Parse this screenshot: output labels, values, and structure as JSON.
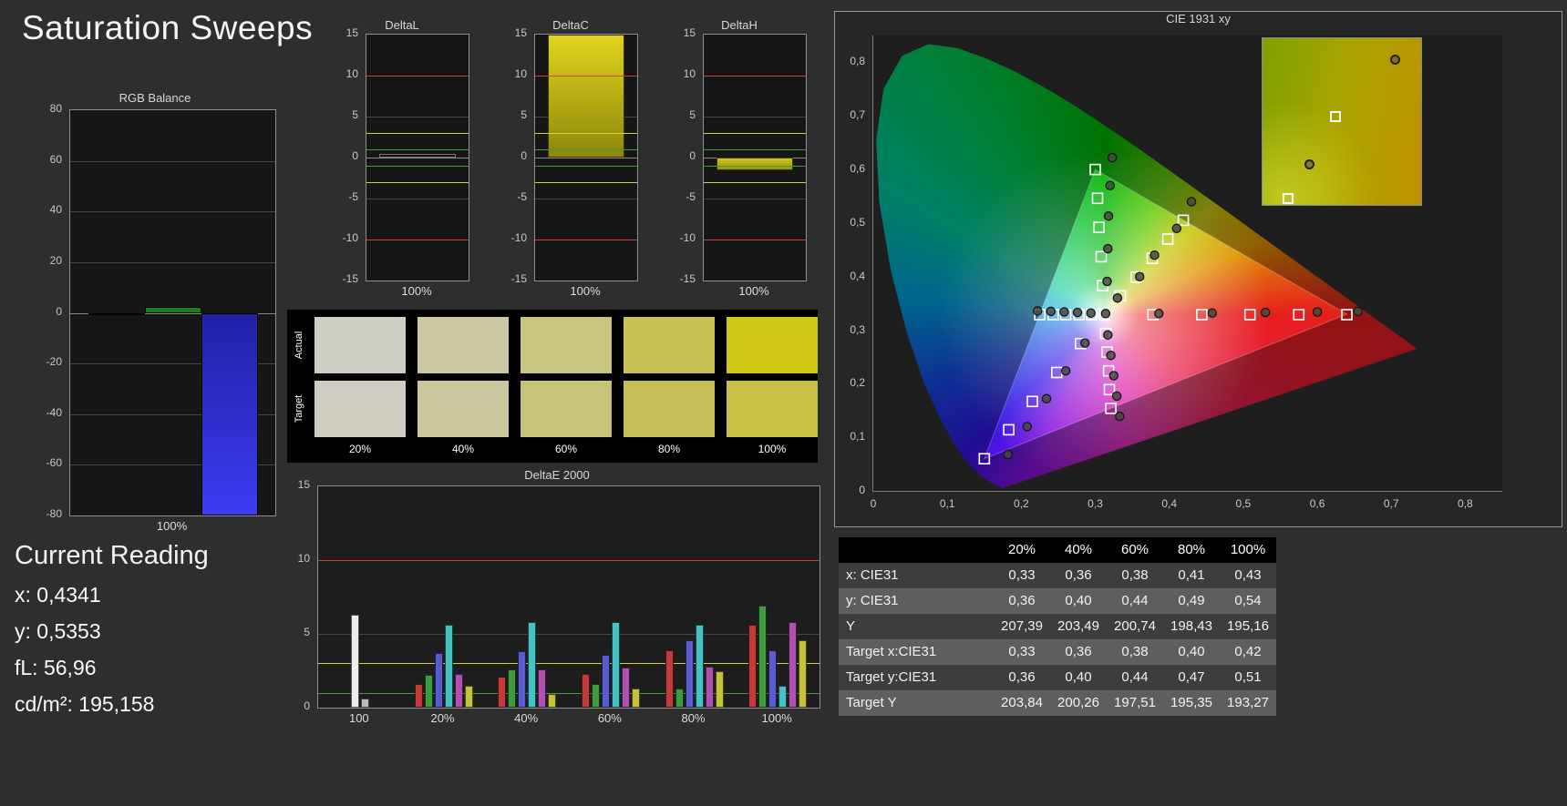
{
  "page": {
    "title": "Saturation Sweeps"
  },
  "colors": {
    "background": "#2e2e2e",
    "panel_border": "#8f8f8f",
    "ref_red": "#d23c3c",
    "ref_yellow": "#d2d23c",
    "ref_green": "#3ca03c"
  },
  "current_reading": {
    "title": "Current Reading",
    "lines": [
      {
        "label": "x:",
        "value": "0,4341"
      },
      {
        "label": "y:",
        "value": "0,5353"
      },
      {
        "label": "fL:",
        "value": "56,96"
      },
      {
        "label": "cd/m²:",
        "value": "195,158"
      }
    ]
  },
  "swatches": {
    "row_labels": [
      "Actual",
      "Target"
    ],
    "labels": [
      "20%",
      "40%",
      "60%",
      "80%",
      "100%"
    ],
    "actual": [
      "#cfcec4",
      "#ccc9a2",
      "#cac57e",
      "#c7c055",
      "#cfc915"
    ],
    "target": [
      "#cfcdc1",
      "#cbc89f",
      "#c8c37b",
      "#c5bf58",
      "#c8c145"
    ]
  },
  "table": {
    "headers": [
      "",
      "20%",
      "40%",
      "60%",
      "80%",
      "100%"
    ],
    "rows": [
      {
        "label": "x: CIE31",
        "values": [
          "0,33",
          "0,36",
          "0,38",
          "0,41",
          "0,43"
        ]
      },
      {
        "label": "y: CIE31",
        "values": [
          "0,36",
          "0,40",
          "0,44",
          "0,49",
          "0,54"
        ]
      },
      {
        "label": "Y",
        "values": [
          "207,39",
          "203,49",
          "200,74",
          "198,43",
          "195,16"
        ]
      },
      {
        "label": "Target x:CIE31",
        "values": [
          "0,33",
          "0,36",
          "0,38",
          "0,40",
          "0,42"
        ]
      },
      {
        "label": "Target y:CIE31",
        "values": [
          "0,36",
          "0,40",
          "0,44",
          "0,47",
          "0,51"
        ]
      },
      {
        "label": "Target Y",
        "values": [
          "203,84",
          "200,26",
          "197,51",
          "195,35",
          "193,27"
        ]
      }
    ],
    "row_bg_dark": "#3d3d3d",
    "row_bg_light": "#5e5e5e"
  },
  "chart_data": [
    {
      "id": "rgb-balance",
      "type": "bar",
      "title": "RGB Balance",
      "categories": [
        "100%"
      ],
      "xlabel": "100%",
      "ylim": [
        -80,
        80
      ],
      "yticks": [
        80,
        60,
        40,
        20,
        0,
        -20,
        -40,
        -60,
        -80
      ],
      "series": [
        {
          "name": "Red",
          "values": [
            -1
          ],
          "color": "#5a1616",
          "border": "#000000"
        },
        {
          "name": "Green",
          "values": [
            2.5
          ],
          "color": "#1d7d1d",
          "border": "#000000"
        },
        {
          "name": "Blue",
          "values": [
            -80
          ],
          "gradient": [
            "#2121a6",
            "#3c3cf2"
          ],
          "border": "#000000"
        }
      ]
    },
    {
      "id": "delta-l",
      "type": "bar",
      "title": "DeltaL",
      "categories": [
        "100%"
      ],
      "xlabel": "100%",
      "values": [
        0.4
      ],
      "ylim": [
        -15,
        15
      ],
      "yticks": [
        15,
        10,
        5,
        0,
        -5,
        -10,
        -15
      ],
      "ref_lines": [
        {
          "y": 10,
          "color": "#d23c3c"
        },
        {
          "y": 3,
          "color": "#d2d23c"
        },
        {
          "y": 1,
          "color": "#3ca03c"
        },
        {
          "y": -1,
          "color": "#3ca03c"
        },
        {
          "y": -3,
          "color": "#d2d23c"
        },
        {
          "y": -10,
          "color": "#d23c3c"
        }
      ],
      "bar_color": "#0e0e0e",
      "bar_border": "#787878"
    },
    {
      "id": "delta-c",
      "type": "bar",
      "title": "DeltaC",
      "categories": [
        "100%"
      ],
      "xlabel": "100%",
      "values": [
        16
      ],
      "ylim": [
        -15,
        15
      ],
      "yticks": [
        15,
        10,
        5,
        0,
        -5,
        -10,
        -15
      ],
      "ref_lines": [
        {
          "y": 10,
          "color": "#d23c3c"
        },
        {
          "y": 3,
          "color": "#d2d23c"
        },
        {
          "y": 1,
          "color": "#3ca03c"
        },
        {
          "y": -1,
          "color": "#3ca03c"
        },
        {
          "y": -3,
          "color": "#d2d23c"
        },
        {
          "y": -10,
          "color": "#d23c3c"
        }
      ],
      "bar_gradient": [
        "#e0d41c",
        "#8e880c"
      ],
      "bar_border": "#3a3800"
    },
    {
      "id": "delta-h",
      "type": "bar",
      "title": "DeltaH",
      "categories": [
        "100%"
      ],
      "xlabel": "100%",
      "values": [
        -1.6
      ],
      "ylim": [
        -15,
        15
      ],
      "yticks": [
        15,
        10,
        5,
        0,
        -5,
        -10,
        -15
      ],
      "ref_lines": [
        {
          "y": 10,
          "color": "#d23c3c"
        },
        {
          "y": 3,
          "color": "#d2d23c"
        },
        {
          "y": 1,
          "color": "#3ca03c"
        },
        {
          "y": -1,
          "color": "#3ca03c"
        },
        {
          "y": -3,
          "color": "#d2d23c"
        },
        {
          "y": -10,
          "color": "#d23c3c"
        }
      ],
      "bar_gradient": [
        "#cfc61e",
        "#9a9310"
      ],
      "bar_border": "#3a3800"
    },
    {
      "id": "deltae-2000",
      "type": "bar",
      "title": "DeltaE 2000",
      "ylim": [
        0,
        15
      ],
      "yticks": [
        0,
        5,
        10,
        15
      ],
      "ref_lines": [
        {
          "y": 10,
          "color": "#d23c3c"
        },
        {
          "y": 3,
          "color": "#d2d23c"
        },
        {
          "y": 1,
          "color": "#3ca03c"
        }
      ],
      "categories": [
        "100",
        "20%",
        "40%",
        "60%",
        "80%",
        "100%"
      ],
      "groups": [
        {
          "label": "100",
          "values": [
            6.3,
            0.6
          ],
          "colors": [
            "#ededed",
            "#bdbdbd"
          ]
        },
        {
          "label": "20%",
          "values": [
            1.6,
            2.2,
            3.7,
            5.6,
            2.3,
            1.5
          ],
          "colors": [
            "#c23b3b",
            "#3f9b3f",
            "#5b5bd0",
            "#46c2c2",
            "#b050b0",
            "#c2c23b"
          ]
        },
        {
          "label": "40%",
          "values": [
            2.1,
            2.6,
            3.8,
            5.8,
            2.6,
            0.9
          ],
          "colors": [
            "#c23b3b",
            "#3f9b3f",
            "#5b5bd0",
            "#46c2c2",
            "#b050b0",
            "#c2c23b"
          ]
        },
        {
          "label": "60%",
          "values": [
            2.3,
            1.6,
            3.6,
            5.8,
            2.7,
            1.3
          ],
          "colors": [
            "#c23b3b",
            "#3f9b3f",
            "#5b5bd0",
            "#46c2c2",
            "#b050b0",
            "#c2c23b"
          ]
        },
        {
          "label": "80%",
          "values": [
            3.9,
            1.3,
            4.6,
            5.6,
            2.8,
            2.5
          ],
          "colors": [
            "#c23b3b",
            "#3f9b3f",
            "#5b5bd0",
            "#46c2c2",
            "#b050b0",
            "#c2c23b"
          ]
        },
        {
          "label": "100%",
          "values": [
            5.6,
            6.9,
            3.9,
            1.5,
            5.8,
            4.6
          ],
          "colors": [
            "#c23b3b",
            "#3f9b3f",
            "#5b5bd0",
            "#46c2c2",
            "#b050b0",
            "#c2c23b"
          ]
        }
      ]
    },
    {
      "id": "cie-1931",
      "type": "scatter",
      "title": "CIE 1931 xy",
      "xlim": [
        0,
        0.85
      ],
      "ylim": [
        0,
        0.85
      ],
      "xtick_labels": [
        "0",
        "0,1",
        "0,2",
        "0,3",
        "0,4",
        "0,5",
        "0,6",
        "0,7",
        "0,8"
      ],
      "ytick_labels": [
        "0",
        "0,1",
        "0,2",
        "0,3",
        "0,4",
        "0,5",
        "0,6",
        "0,7",
        "0,8"
      ],
      "white_point": [
        0.3127,
        0.329
      ],
      "gamut_triangle": [
        [
          0.64,
          0.33
        ],
        [
          0.3,
          0.6
        ],
        [
          0.15,
          0.06
        ]
      ],
      "spectral_locus": [
        [
          0.1741,
          0.005
        ],
        [
          0.1566,
          0.0177
        ],
        [
          0.144,
          0.0297
        ],
        [
          0.1241,
          0.0578
        ],
        [
          0.1096,
          0.0868
        ],
        [
          0.0913,
          0.1327
        ],
        [
          0.0687,
          0.2007
        ],
        [
          0.0454,
          0.295
        ],
        [
          0.0235,
          0.4127
        ],
        [
          0.0082,
          0.5384
        ],
        [
          0.0039,
          0.6548
        ],
        [
          0.0139,
          0.7502
        ],
        [
          0.0389,
          0.812
        ],
        [
          0.0743,
          0.8338
        ],
        [
          0.1142,
          0.8262
        ],
        [
          0.1547,
          0.8059
        ],
        [
          0.1929,
          0.7816
        ],
        [
          0.2296,
          0.7543
        ],
        [
          0.2658,
          0.7243
        ],
        [
          0.3016,
          0.6923
        ],
        [
          0.3373,
          0.6589
        ],
        [
          0.3731,
          0.6245
        ],
        [
          0.4087,
          0.5896
        ],
        [
          0.4441,
          0.5547
        ],
        [
          0.4788,
          0.5202
        ],
        [
          0.5125,
          0.4866
        ],
        [
          0.5448,
          0.4544
        ],
        [
          0.5752,
          0.4242
        ],
        [
          0.6029,
          0.3965
        ],
        [
          0.627,
          0.3725
        ],
        [
          0.6658,
          0.334
        ],
        [
          0.6915,
          0.3083
        ],
        [
          0.719,
          0.2809
        ],
        [
          0.7347,
          0.2653
        ]
      ],
      "target_points": [
        [
          0.3127,
          0.329
        ],
        [
          0.378,
          0.329
        ],
        [
          0.444,
          0.329
        ],
        [
          0.509,
          0.329
        ],
        [
          0.575,
          0.329
        ],
        [
          0.64,
          0.329
        ],
        [
          0.31,
          0.383
        ],
        [
          0.308,
          0.437
        ],
        [
          0.305,
          0.492
        ],
        [
          0.303,
          0.546
        ],
        [
          0.3,
          0.6
        ],
        [
          0.28,
          0.275
        ],
        [
          0.248,
          0.221
        ],
        [
          0.215,
          0.167
        ],
        [
          0.183,
          0.114
        ],
        [
          0.15,
          0.06
        ],
        [
          0.295,
          0.329
        ],
        [
          0.278,
          0.329
        ],
        [
          0.26,
          0.329
        ],
        [
          0.243,
          0.329
        ],
        [
          0.225,
          0.329
        ],
        [
          0.314,
          0.294
        ],
        [
          0.316,
          0.259
        ],
        [
          0.318,
          0.224
        ],
        [
          0.319,
          0.189
        ],
        [
          0.321,
          0.154
        ],
        [
          0.334,
          0.364
        ],
        [
          0.355,
          0.399
        ],
        [
          0.377,
          0.434
        ],
        [
          0.398,
          0.47
        ],
        [
          0.419,
          0.505
        ]
      ],
      "measured_points": [
        [
          0.314,
          0.331
        ],
        [
          0.386,
          0.331
        ],
        [
          0.458,
          0.332
        ],
        [
          0.53,
          0.333
        ],
        [
          0.6,
          0.334
        ],
        [
          0.655,
          0.335
        ],
        [
          0.316,
          0.391
        ],
        [
          0.317,
          0.452
        ],
        [
          0.318,
          0.513
        ],
        [
          0.32,
          0.57
        ],
        [
          0.323,
          0.622
        ],
        [
          0.286,
          0.276
        ],
        [
          0.26,
          0.224
        ],
        [
          0.234,
          0.172
        ],
        [
          0.208,
          0.12
        ],
        [
          0.182,
          0.068
        ],
        [
          0.294,
          0.332
        ],
        [
          0.276,
          0.333
        ],
        [
          0.258,
          0.334
        ],
        [
          0.24,
          0.335
        ],
        [
          0.222,
          0.336
        ],
        [
          0.317,
          0.291
        ],
        [
          0.321,
          0.253
        ],
        [
          0.325,
          0.215
        ],
        [
          0.329,
          0.177
        ],
        [
          0.333,
          0.139
        ],
        [
          0.33,
          0.36
        ],
        [
          0.36,
          0.4
        ],
        [
          0.38,
          0.44
        ],
        [
          0.41,
          0.49
        ],
        [
          0.43,
          0.54
        ]
      ],
      "inset": {
        "points": [
          {
            "shape": "square",
            "x": 46,
            "y": 47
          },
          {
            "shape": "circle",
            "x": 84,
            "y": 13
          },
          {
            "shape": "circle",
            "x": 30,
            "y": 76
          },
          {
            "shape": "square",
            "x": 16,
            "y": 96
          }
        ]
      }
    }
  ]
}
